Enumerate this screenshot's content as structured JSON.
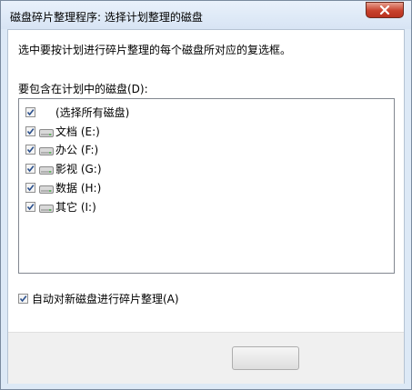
{
  "window": {
    "title": "磁盘碎片整理程序: 选择计划整理的磁盘"
  },
  "instruction": "选中要按计划进行碎片整理的每个磁盘所对应的复选框。",
  "disk_group_label": "要包含在计划中的磁盘(D):",
  "disk_list": {
    "select_all": {
      "label": "(选择所有磁盘)",
      "checked": true
    },
    "items": [
      {
        "label": "文档 (E:)",
        "checked": true,
        "icon": "drive-icon"
      },
      {
        "label": "办公 (F:)",
        "checked": true,
        "icon": "drive-icon"
      },
      {
        "label": "影视 (G:)",
        "checked": true,
        "icon": "drive-icon"
      },
      {
        "label": "数据 (H:)",
        "checked": true,
        "icon": "drive-icon"
      },
      {
        "label": "其它 (I:)",
        "checked": true,
        "icon": "drive-icon"
      }
    ]
  },
  "auto_defrag": {
    "label": "自动对新磁盘进行碎片整理(A)",
    "checked": true
  },
  "footer": {
    "ok_label": ""
  }
}
